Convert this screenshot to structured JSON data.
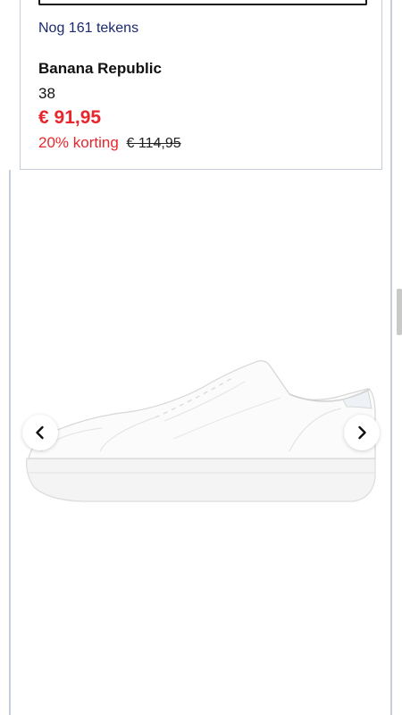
{
  "form": {
    "chars_remaining": "Nog 161 tekens"
  },
  "product": {
    "brand": "Banana Republic",
    "size": "38",
    "price": "€ 91,95",
    "discount": "20% korting",
    "original_price": "€ 114,95",
    "image_alt": "white leather sneaker"
  },
  "gallery": {
    "prev_icon": "chevron-left-icon",
    "next_icon": "chevron-right-icon"
  },
  "colors": {
    "sale_red": "#e8262c",
    "link_navy": "#1a2a6e",
    "border_gray": "#c7cedb"
  }
}
